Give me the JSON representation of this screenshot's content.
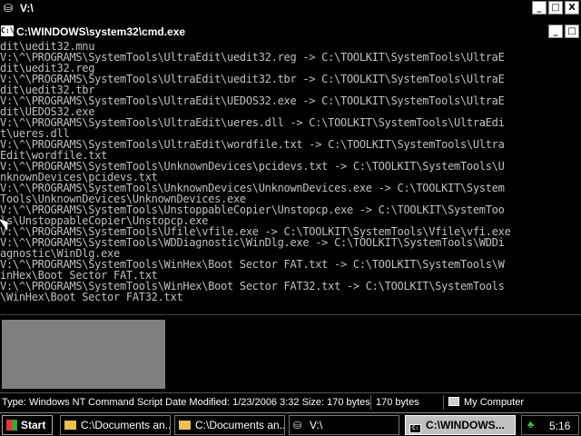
{
  "explorer_window": {
    "title": "V:\\"
  },
  "cmd_window": {
    "title": "C:\\WINDOWS\\system32\\cmd.exe",
    "icon_label": "C:\\",
    "lines": [
      "dit\\uedit32.mnu",
      "V:\\^\\PROGRAMS\\SystemTools\\UltraEdit\\uedit32.reg -> C:\\TOOLKIT\\SystemTools\\UltraE",
      "dit\\uedit32.reg",
      "V:\\^\\PROGRAMS\\SystemTools\\UltraEdit\\uedit32.tbr -> C:\\TOOLKIT\\SystemTools\\UltraE",
      "dit\\uedit32.tbr",
      "V:\\^\\PROGRAMS\\SystemTools\\UltraEdit\\UEDOS32.exe -> C:\\TOOLKIT\\SystemTools\\UltraE",
      "dit\\UEDOS32.exe",
      "V:\\^\\PROGRAMS\\SystemTools\\UltraEdit\\ueres.dll -> C:\\TOOLKIT\\SystemTools\\UltraEdi",
      "t\\ueres.dll",
      "V:\\^\\PROGRAMS\\SystemTools\\UltraEdit\\wordfile.txt -> C:\\TOOLKIT\\SystemTools\\Ultra",
      "Edit\\wordfile.txt",
      "V:\\^\\PROGRAMS\\SystemTools\\UnknownDevices\\pcidevs.txt -> C:\\TOOLKIT\\SystemTools\\U",
      "nknownDevices\\pcidevs.txt",
      "V:\\^\\PROGRAMS\\SystemTools\\UnknownDevices\\UnknownDevices.exe -> C:\\TOOLKIT\\System",
      "Tools\\UnknownDevices\\UnknownDevices.exe",
      "V:\\^\\PROGRAMS\\SystemTools\\UnstoppableCopier\\Unstopcp.exe -> C:\\TOOLKIT\\SystemToo",
      "ls\\UnstoppableCopier\\Unstopcp.exe",
      "V:\\^\\PROGRAMS\\SystemTools\\Ufile\\vfile.exe -> C:\\TOOLKIT\\SystemTools\\Vfile\\vfi.exe",
      "V:\\^\\PROGRAMS\\SystemTools\\WDDiagnostic\\WinDlg.exe -> C:\\TOOLKIT\\SystemTools\\WDDi",
      "agnostic\\WinDlg.exe",
      "V:\\^\\PROGRAMS\\SystemTools\\WinHex\\Boot Sector FAT.txt -> C:\\TOOLKIT\\SystemTools\\W",
      "inHex\\Boot Sector FAT.txt",
      "V:\\^\\PROGRAMS\\SystemTools\\WinHex\\Boot Sector FAT32.txt -> C:\\TOOLKIT\\SystemTools",
      "\\WinHex\\Boot Sector FAT32.txt"
    ]
  },
  "window_buttons": {
    "minimize": "_",
    "maximize": "□",
    "close": "X"
  },
  "statusbar": {
    "description": "Type: Windows NT Command Script Date Modified: 1/23/2006 3:32 Size: 170 bytes",
    "size": "170 bytes",
    "zone": "My Computer"
  },
  "taskbar": {
    "start_label": "Start",
    "tasks": [
      {
        "label": "C:\\Documents an...",
        "icon": "folder-icon"
      },
      {
        "label": "C:\\Documents an...",
        "icon": "folder-icon"
      },
      {
        "label": "V:\\",
        "icon": "drive-icon"
      },
      {
        "label": "C:\\WINDOWS...",
        "icon": "cmd-icon",
        "active": true
      }
    ],
    "clock": "5:16"
  },
  "colors": {
    "console_text": "#c0c0c0",
    "background": "#000000",
    "preview": "#7f7f7f"
  }
}
